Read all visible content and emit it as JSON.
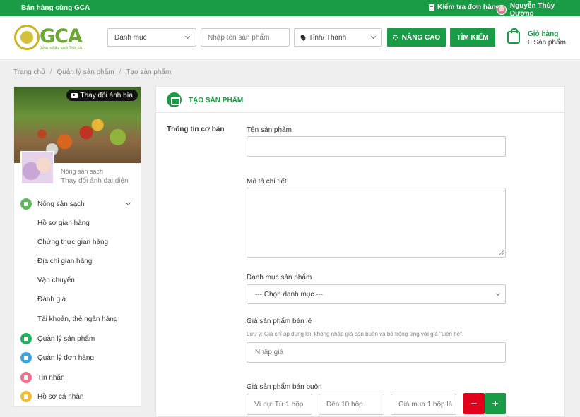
{
  "topbar": {
    "brand": "Bán hàng cùng GCA",
    "orders": "Kiểm tra đơn hàng",
    "user": "Nguyễn Thùy Dương"
  },
  "header": {
    "logo_word": "GCA",
    "logo_tagline": "Nông nghiệp sạch Toàn cầu",
    "category_select": "Danh mục",
    "product_placeholder": "Nhập tên sản phẩm",
    "province_select": "Tỉnh/ Thành",
    "advanced_btn": "NÂNG CAO",
    "search_btn": "TÌM KIẾM",
    "cart_label": "Giỏ hàng",
    "cart_count": "0 Sản phẩm"
  },
  "breadcrumb": [
    "Trang chủ",
    "Quản lý sản phẩm",
    "Tạo sản phẩm"
  ],
  "sidebar": {
    "cover_btn": "Thay đổi ảnh bìa",
    "shop_name": "Nông sản sạch",
    "change_avatar": "Thay đổi ảnh đại diện",
    "main_menu": [
      {
        "label": "Nông sản sạch",
        "icon": "home-icon",
        "color": "#5cb85c"
      },
      {
        "label": "Quản lý sản phẩm",
        "icon": "leaf-icon",
        "color": "#21b25b"
      },
      {
        "label": "Quản lý đơn hàng",
        "icon": "document-icon",
        "color": "#3da6e0"
      },
      {
        "label": "Tin nhắn",
        "icon": "message-icon",
        "color": "#ef6f8f"
      },
      {
        "label": "Hồ sơ cá nhân",
        "icon": "user-icon",
        "color": "#f5b935"
      }
    ],
    "sub_menu": [
      "Hồ sơ gian hàng",
      "Chứng thực gian hàng",
      "Địa chỉ gian hàng",
      "Vận chuyển",
      "Đánh giá",
      "Tài khoản, thẻ ngân hàng"
    ]
  },
  "form": {
    "title": "TẠO SẢN PHẨM",
    "section": "Thông tin cơ bản",
    "name_label": "Tên sản phẩm",
    "desc_label": "Mô tả chi tiết",
    "category_label": "Danh mục sản phẩm",
    "category_value": "--- Chọn danh mục ---",
    "retail_label": "Giá sản phẩm bán lẻ",
    "retail_note": "Lưu ý: Giá chỉ áp dụng khi không nhập giá bán buôn và bỏ trống ứng với giá \"Liên hệ\".",
    "price_placeholder": "Nhập giá",
    "wholesale_label": "Giá sản phẩm bán buôn",
    "from_placeholder": "Ví dụ: Từ 1 hộp",
    "to_placeholder": "Đến 10 hộp",
    "unit_price_placeholder": "Giá mua 1 hộp là",
    "remove_btn": "−",
    "add_btn": "+"
  },
  "colors": {
    "accent": "#1a9b45",
    "danger": "#e3001b"
  }
}
